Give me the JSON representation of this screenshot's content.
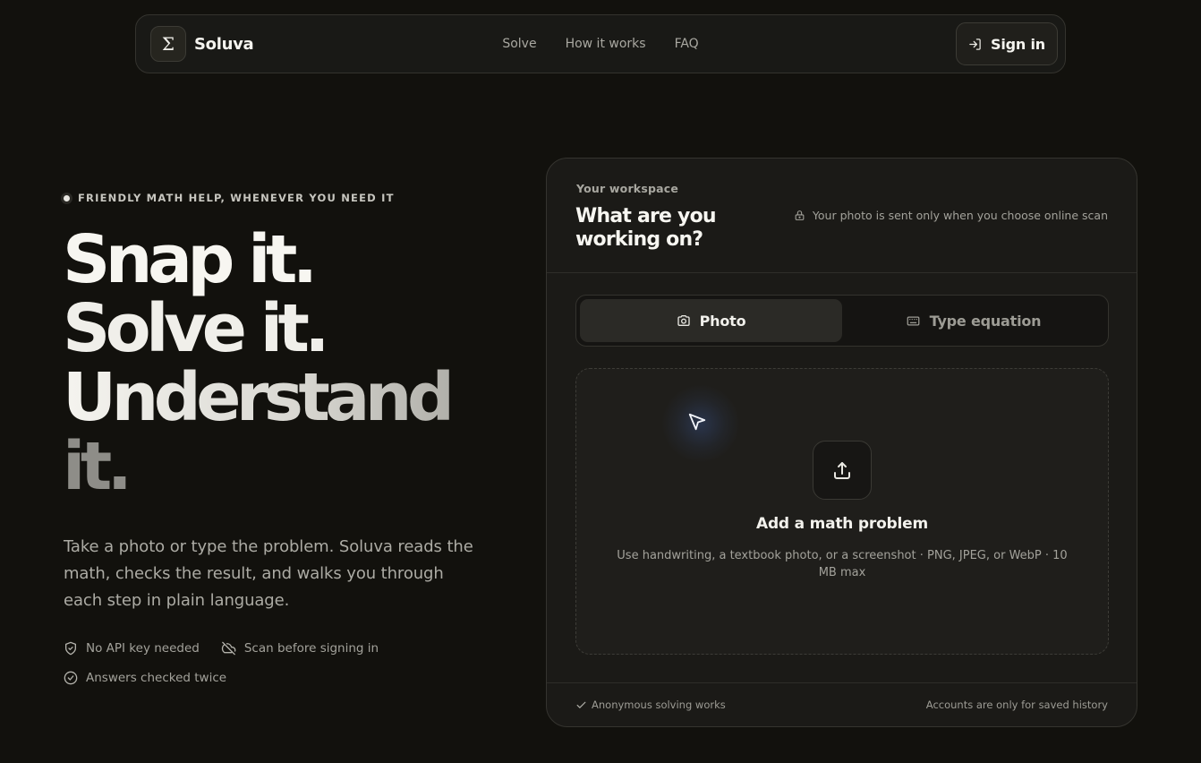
{
  "nav": {
    "logo_glyph": "Σ",
    "brand": "Soluva",
    "links": [
      "Solve",
      "How it works",
      "FAQ"
    ],
    "signin_label": "Sign in"
  },
  "hero": {
    "eyebrow": "FRIENDLY MATH HELP, WHENEVER YOU NEED IT",
    "headline": [
      "Snap it.",
      "Solve it.",
      "Understand",
      "it."
    ],
    "lede": "Take a photo or type the problem. Soluva reads the math, checks the result, and walks you through each step in plain language.",
    "features": [
      {
        "icon": "shield-check-icon",
        "label": "No API key needed"
      },
      {
        "icon": "cloud-off-icon",
        "label": "Scan before signing in"
      },
      {
        "icon": "check-circle-icon",
        "label": "Answers checked twice"
      }
    ]
  },
  "workspace": {
    "label": "Your workspace",
    "title": "What are you working on?",
    "privacy_note": "Your photo is sent only when you choose online scan",
    "tabs": [
      {
        "icon": "camera-icon",
        "label": "Photo",
        "active": true
      },
      {
        "icon": "keyboard-icon",
        "label": "Type equation",
        "active": false
      }
    ],
    "dropzone": {
      "title": "Add a math problem",
      "subtitle": "Use handwriting, a textbook photo, or a screenshot · PNG, JPEG, or WebP · 10 MB max"
    },
    "footer_left": "Anonymous solving works",
    "footer_right": "Accounts are only for saved history"
  },
  "colors": {
    "background": "#12110d",
    "card": "#1b1a17",
    "accent_glow": "#466ec8"
  }
}
